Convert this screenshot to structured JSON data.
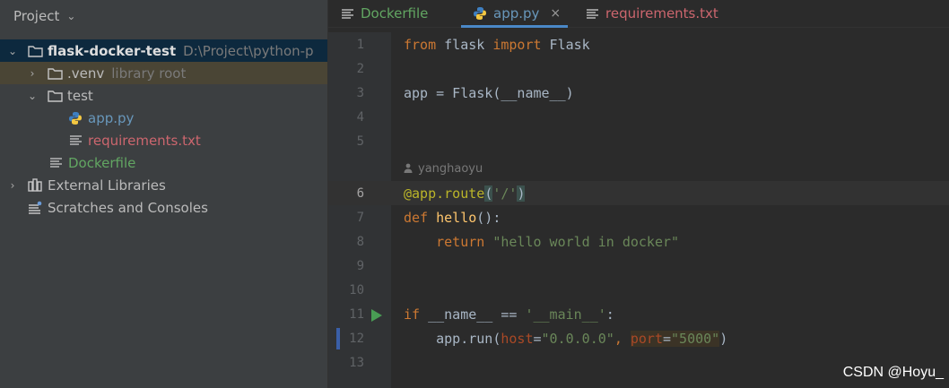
{
  "project_panel": {
    "title": "Project",
    "tree": [
      {
        "label": "flask-docker-test",
        "hint": "D:\\Project\\python-p"
      },
      {
        "label": ".venv",
        "hint": "library root"
      },
      {
        "label": "test"
      },
      {
        "label": "app.py"
      },
      {
        "label": "requirements.txt"
      },
      {
        "label": "Dockerfile"
      },
      {
        "label": "External Libraries"
      },
      {
        "label": "Scratches and Consoles"
      }
    ]
  },
  "editor": {
    "tabs": [
      {
        "label": "Dockerfile"
      },
      {
        "label": "app.py",
        "close": "×"
      },
      {
        "label": "requirements.txt"
      }
    ],
    "author": "yanghaoyu",
    "line_numbers": [
      "1",
      "2",
      "3",
      "4",
      "5",
      "6",
      "7",
      "8",
      "9",
      "10",
      "11",
      "12",
      "13"
    ],
    "code": {
      "l1": {
        "t1": "from",
        "t2": " flask ",
        "t3": "import",
        "t4": " Flask"
      },
      "l3": {
        "t1": "app = Flask(__name__)"
      },
      "l6": {
        "t1": "@app.route",
        "t2": "(",
        "t3": "'/'",
        "t4": ")"
      },
      "l7": {
        "t1": "def",
        "t2": " ",
        "t3": "hello",
        "t4": "():"
      },
      "l8": {
        "t1": "    ",
        "t2": "return",
        "t3": " ",
        "t4": "\"hello world in docker\""
      },
      "l11": {
        "t1": "if",
        "t2": " __name__ == ",
        "t3": "'__main__'",
        "t4": ":"
      },
      "l12": {
        "t1": "    app.run(",
        "t2": "host",
        "t3": "=",
        "t4": "\"0.0.0.0\"",
        "t5": ", ",
        "t6": "port",
        "t7": "=",
        "t8": "\"5000\"",
        "t9": ")"
      }
    }
  },
  "watermark": "CSDN @Hoyu_"
}
